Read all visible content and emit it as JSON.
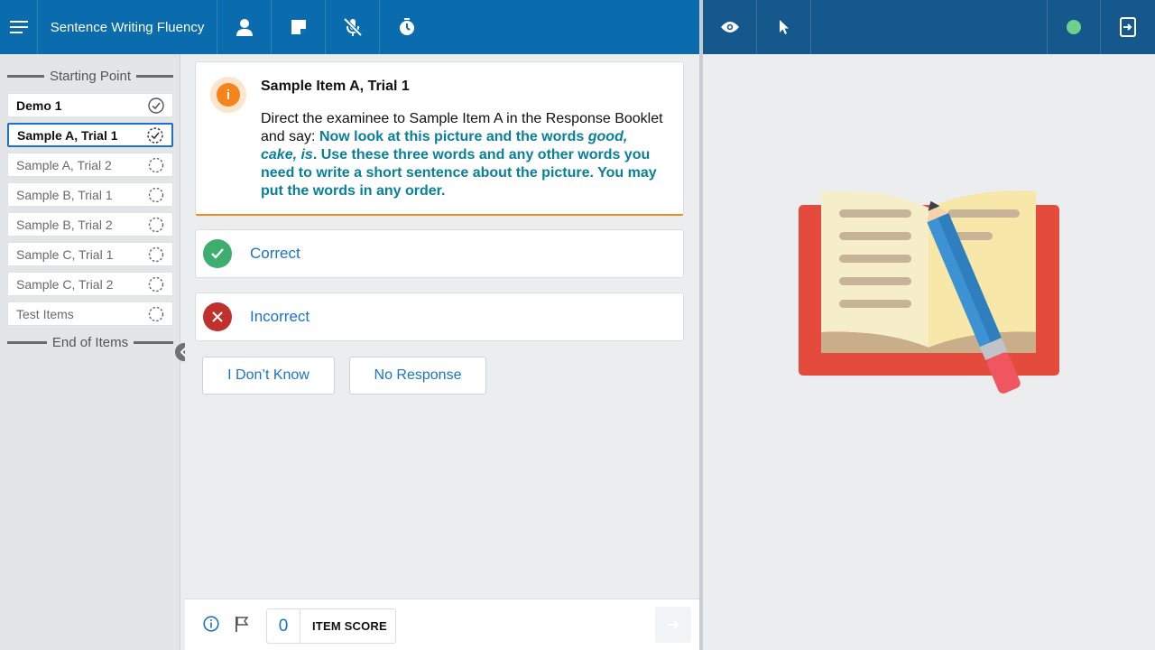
{
  "header": {
    "app_title": "Sentence Writing Fluency",
    "icons": [
      "menu-icon",
      "person-icon",
      "note-icon",
      "mic-off-icon",
      "timer-icon"
    ],
    "right_icons": [
      "eye-icon",
      "pointer-icon",
      "status-dot-icon",
      "screen-share-icon"
    ],
    "status_color": "#6fd08c"
  },
  "sidebar": {
    "start_label": "Starting Point",
    "end_label": "End of Items",
    "items": [
      {
        "label": "Demo 1",
        "state": "done"
      },
      {
        "label": "Sample A, Trial 1",
        "state": "active"
      },
      {
        "label": "Sample A, Trial 2",
        "state": "pending"
      },
      {
        "label": "Sample B, Trial 1",
        "state": "pending"
      },
      {
        "label": "Sample B, Trial 2",
        "state": "pending"
      },
      {
        "label": "Sample C, Trial 1",
        "state": "pending"
      },
      {
        "label": "Sample C, Trial 2",
        "state": "pending"
      },
      {
        "label": "Test Items",
        "state": "pending"
      }
    ]
  },
  "card": {
    "title": "Sample Item A, Trial 1",
    "instruction": "Direct the examinee to Sample Item A in the Response Booklet and say: ",
    "say_1": "Now look at this picture and the words ",
    "say_words": "good, cake, is",
    "say_2": ". Use these three words and any other words you need to write a short sentence about the picture. You may put the words in any order.",
    "accent_color": "#f08b1c"
  },
  "answers": {
    "correct_label": "Correct",
    "incorrect_label": "Incorrect",
    "correct_color": "#3dae6d",
    "incorrect_color": "#c0302c"
  },
  "buttons": {
    "dont_know": "I Don’t Know",
    "no_response": "No Response"
  },
  "footer": {
    "score_value": "0",
    "score_label": "ITEM SCORE"
  }
}
